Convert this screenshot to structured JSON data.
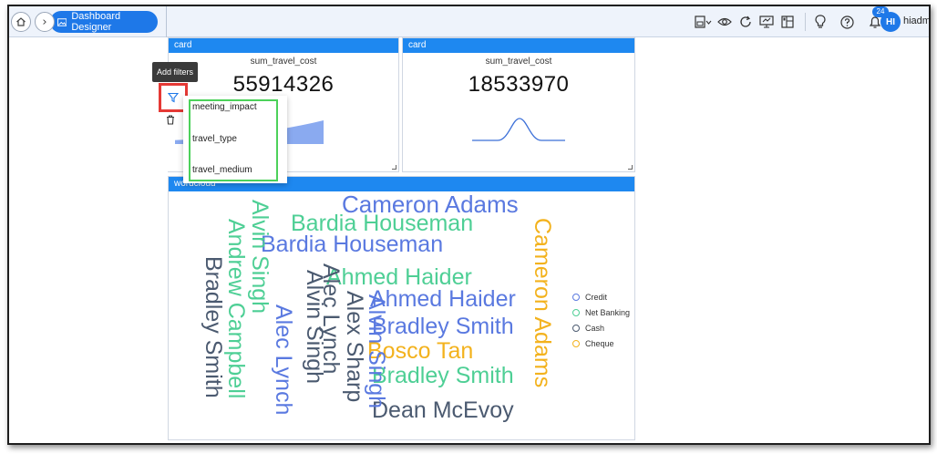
{
  "breadcrumb": {
    "current": "Dashboard Designer"
  },
  "header": {
    "notification_count": "24",
    "user_initials": "HI",
    "user_name": "hiadm"
  },
  "toolbar_icons": [
    "save-dropdown-icon",
    "eye-icon",
    "refresh-icon",
    "present-icon",
    "layout-icon",
    "lightbulb-icon",
    "help-icon",
    "notification-icon"
  ],
  "card1": {
    "title": "card",
    "measure": "sum_travel_cost",
    "value": "55914326"
  },
  "card2": {
    "title": "card",
    "measure": "sum_travel_cost",
    "value": "18533970"
  },
  "wordcloud": {
    "title": "wordcloud"
  },
  "words": [
    {
      "text": "Cameron Adams",
      "color": "#5a79e0"
    },
    {
      "text": "Bardia Houseman",
      "color": "#4ecf95"
    },
    {
      "text": "Bardia Houseman",
      "color": "#5a79e0"
    },
    {
      "text": "Ahmed Haider",
      "color": "#4ecf95"
    },
    {
      "text": "Ahmed Haider",
      "color": "#5a79e0"
    },
    {
      "text": "Bradley Smith",
      "color": "#5a79e0"
    },
    {
      "text": "Bosco Tan",
      "color": "#f3b21d"
    },
    {
      "text": "Bradley Smith",
      "color": "#4ecf95"
    },
    {
      "text": "Dean McEvoy",
      "color": "#4b5a70"
    },
    {
      "text": "Bradley Smith",
      "color": "#4b5a70"
    },
    {
      "text": "Andrew Campbell",
      "color": "#4ecf95"
    },
    {
      "text": "Alvin Singh",
      "color": "#4ecf95"
    },
    {
      "text": "Alec Lynch",
      "color": "#5a79e0"
    },
    {
      "text": "Alvin Singh",
      "color": "#4b5a70"
    },
    {
      "text": "Alec Lynch",
      "color": "#4b5a70"
    },
    {
      "text": "Alex Sharp",
      "color": "#4b5a70"
    },
    {
      "text": "Alvin Singh",
      "color": "#5a79e0"
    },
    {
      "text": "Cameron Adams",
      "color": "#f3b21d"
    }
  ],
  "legend": [
    {
      "label": "Credit",
      "color": "#5a79e0"
    },
    {
      "label": "Net Banking",
      "color": "#4ecf95"
    },
    {
      "label": "Cash",
      "color": "#4b5a70"
    },
    {
      "label": "Cheque",
      "color": "#f3b21d"
    }
  ],
  "tooltip": {
    "text": "Add filters"
  },
  "filter_menu": {
    "items": [
      "meeting_impact",
      "travel_type",
      "travel_medium"
    ]
  }
}
